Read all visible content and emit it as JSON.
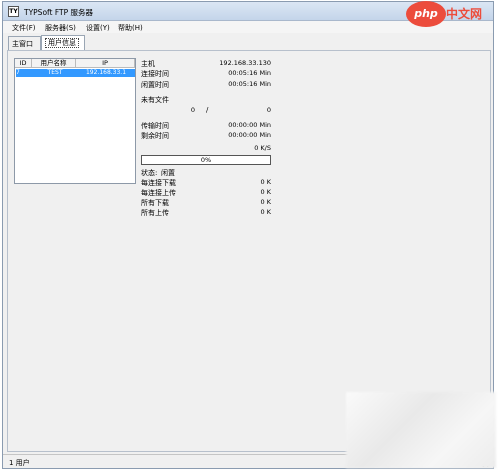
{
  "window": {
    "title": "TYPSoft FTP 服务器",
    "icon_glyph": "TY"
  },
  "menu": {
    "items": [
      "文件(F)",
      "服务器(S)",
      "设置(Y)",
      "帮助(H)"
    ]
  },
  "tabs": [
    "主窗口",
    "用户信息"
  ],
  "user_list": {
    "headers": [
      "ID",
      "用户名称",
      "IP"
    ],
    "rows": [
      {
        "id": "7",
        "name": "TEST",
        "ip": "192.168.33.1"
      }
    ]
  },
  "info": {
    "host_label": "主机",
    "host_value": "192.168.33.130",
    "connect_time_label": "连接时间",
    "connect_time_value": "00:05:16 Min",
    "idle_time_label": "闲置时间",
    "idle_time_value": "00:05:16 Min",
    "no_file_label": "未有文件",
    "count_current": "0",
    "count_sep": "/",
    "count_total": "0",
    "transfer_time_label": "传输时间",
    "transfer_time_value": "00:00:00 Min",
    "remaining_time_label": "剩余时间",
    "remaining_time_value": "00:00:00 Min",
    "speed_value": "0 K/S",
    "progress_text": "0%",
    "progress_fraction": 0,
    "status_label": "状态:",
    "status_value": "闲置",
    "per_conn_down_label": "每连接下载",
    "per_conn_down_value": "0 K",
    "per_conn_up_label": "每连接上传",
    "per_conn_up_value": "0 K",
    "all_down_label": "所有下载",
    "all_down_value": "0 K",
    "all_up_label": "所有上传",
    "all_up_value": "0 K"
  },
  "statusbar": {
    "text": "1 用户"
  },
  "watermark": {
    "php": "php",
    "cn": "中文网"
  },
  "colors": {
    "selection": "#3399ff",
    "brand": "#ec4c3c"
  }
}
